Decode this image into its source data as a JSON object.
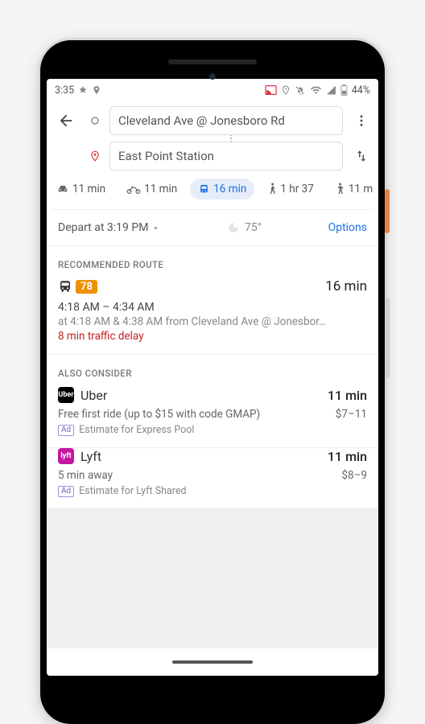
{
  "status": {
    "time": "3:35",
    "battery": "44%"
  },
  "route": {
    "origin": "Cleveland Ave @ Jonesboro Rd",
    "destination": "East Point Station"
  },
  "modes": {
    "car": "11 min",
    "motorcycle": "11 min",
    "transit": "16 min",
    "walk": "1 hr 37",
    "ride": "11 m"
  },
  "controls": {
    "depart_label": "Depart at 3:19 PM",
    "temp": "75°",
    "options_label": "Options"
  },
  "recommended": {
    "label": "RECOMMENDED ROUTE",
    "bus_number": "78",
    "duration": "16 min",
    "times": "4:18 AM – 4:34 AM",
    "details": "at 4:18 AM & 4:38 AM from Cleveland Ave @ Jonesbor…",
    "delay": "8 min traffic delay"
  },
  "also": {
    "label": "ALSO CONSIDER",
    "options": [
      {
        "logo": "Uber",
        "name": "Uber",
        "duration": "11 min",
        "subtitle": "Free first ride (up to $15 with code GMAP)",
        "price": "$7–11",
        "ad_badge": "Ad",
        "ad_text": "Estimate for Express Pool"
      },
      {
        "logo": "lyft",
        "name": "Lyft",
        "duration": "11 min",
        "subtitle": "5 min away",
        "price": "$8–9",
        "ad_badge": "Ad",
        "ad_text": "Estimate for Lyft Shared"
      }
    ]
  }
}
